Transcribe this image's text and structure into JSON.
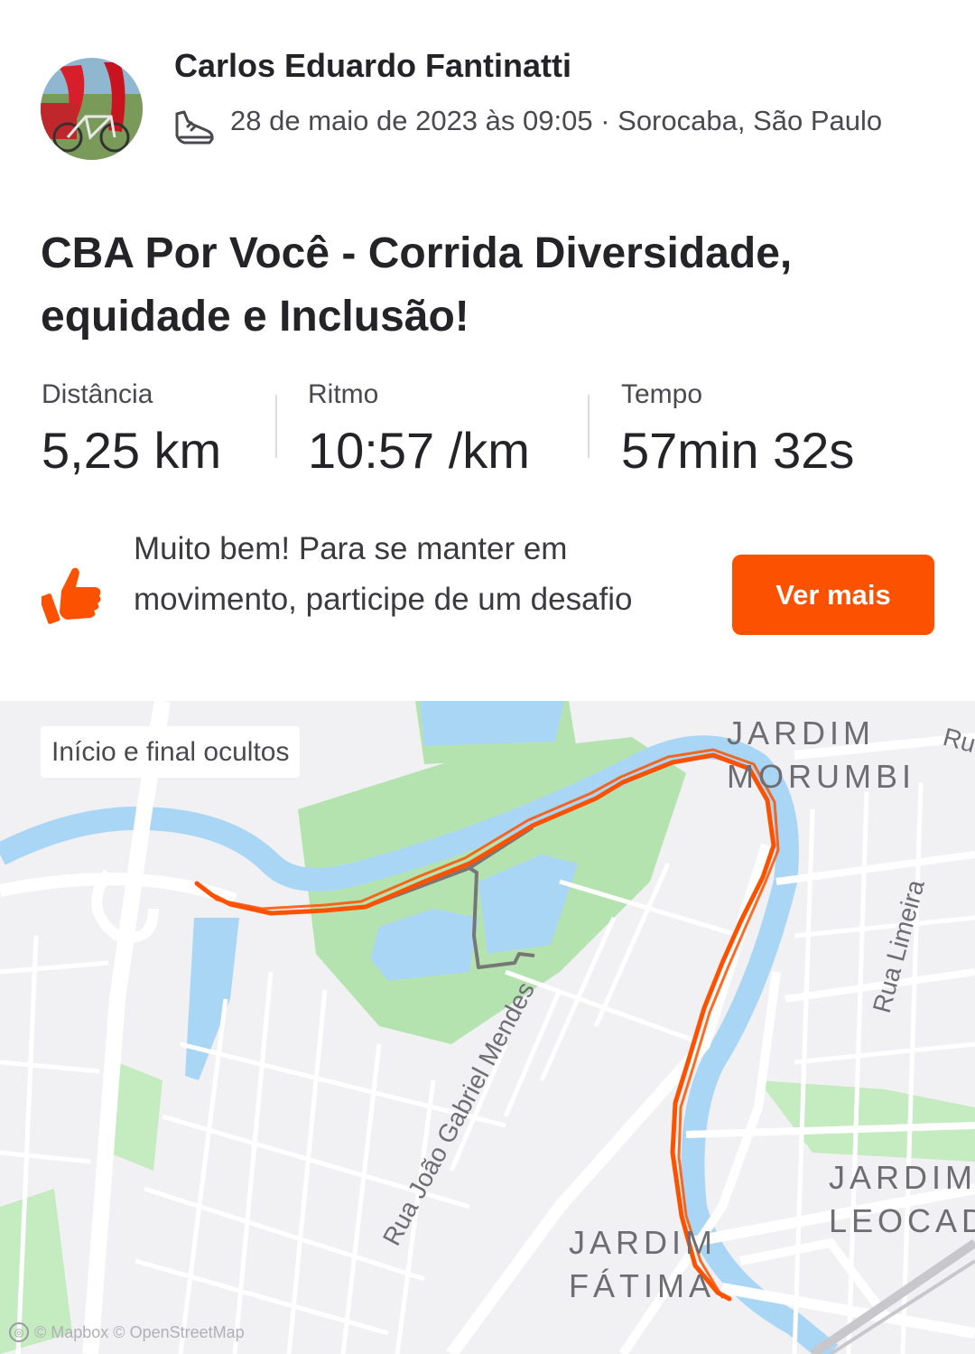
{
  "activity": {
    "athlete_name": "Carlos Eduardo Fantinatti",
    "activity_icon": "running-shoe-icon",
    "date_location": "28 de maio de 2023 às 09:05 · Sorocaba, São Paulo",
    "title": "CBA Por Você - Corrida Diversidade, equidade e Inclusão!"
  },
  "stats": [
    {
      "label": "Distância",
      "value": "5,25 km"
    },
    {
      "label": "Ritmo",
      "value": "10:57 /km"
    },
    {
      "label": "Tempo",
      "value": "57min 32s"
    }
  ],
  "promo": {
    "icon": "thumbs-up-icon",
    "text": "Muito bem! Para se manter em movimento, participe de um desafio",
    "button_label": "Ver mais"
  },
  "map": {
    "privacy_label": "Início e final ocultos",
    "attribution": "© Mapbox © OpenStreetMap",
    "labels": {
      "jardim_morumbi": "JARDIM MORUMBI",
      "jardim_leocadia": "JARDIM LEOCADI",
      "jardim_fatima": "JARDIM FÁTIMA",
      "rua_joao_gabriel_mendes": "Rua João Gabriel Mendes",
      "rua_limeira": "Rua Limeira",
      "rua_partial": "Ru"
    }
  },
  "colors": {
    "accent": "#fc5200",
    "route_hidden": "#777777",
    "water": "#aad6f5",
    "park": "#b5e3b0",
    "road": "#ffffff",
    "map_background": "#f1f1f4"
  }
}
